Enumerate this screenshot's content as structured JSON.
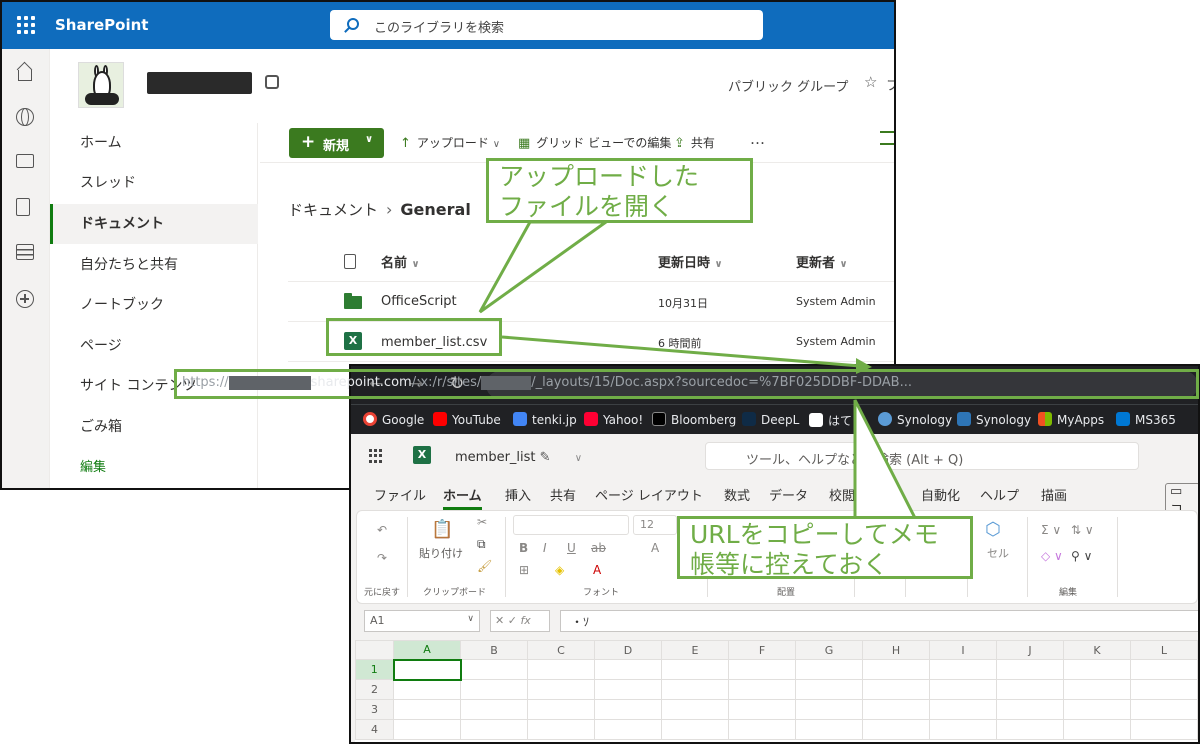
{
  "sharepoint": {
    "brand": "SharePoint",
    "search_placeholder": "このライブラリを検索",
    "group_type": "パブリック グループ",
    "group_more": "フ",
    "nav": [
      "ホーム",
      "スレッド",
      "ドキュメント",
      "自分たちと共有",
      "ノートブック",
      "ページ",
      "サイト コンテンツ",
      "ごみ箱",
      "編集"
    ],
    "active_nav": "ドキュメント",
    "commands": {
      "new": "新規",
      "upload": "アップロード",
      "grid_edit": "グリッド ビューでの編集",
      "share": "共有",
      "more": "…"
    },
    "breadcrumb": {
      "root": "ドキュメント",
      "current": "General"
    },
    "columns": {
      "name": "名前",
      "modified": "更新日時",
      "modified_by": "更新者"
    },
    "files": [
      {
        "name": "OfficeScript",
        "modified": "10月31日",
        "modified_by": "System Admin",
        "icon": "folder-icon"
      },
      {
        "name": "member_list.csv",
        "modified": "6 時間前",
        "modified_by": "System Admin",
        "icon": "excel-icon"
      }
    ]
  },
  "callouts": {
    "open_file_line1": "アップロードした",
    "open_file_line2": "ファイルを開く",
    "copy_url_line1": "URLをコピーしてメモ",
    "copy_url_line2": "帳等に控えておく"
  },
  "accent_color": "#70ad47",
  "browser": {
    "url_prefix": "https://",
    "url_host": "sharepoint.com",
    "url_path1": "/:x:/r/sites/",
    "url_path2": "/_layouts/15/Doc.aspx?sourcedoc=%7BF025DDBF-DDAB...",
    "bookmarks": [
      "Google",
      "YouTube",
      "tenki.jp",
      "Yahoo!",
      "Bloomberg",
      "DeepL",
      "はてブ",
      "Synology",
      "Synology",
      "MyApps",
      "MS365"
    ]
  },
  "excel": {
    "file_name": "member_list",
    "search_placeholder": "ツール、ヘルプなどを検索 (Alt + Q)",
    "tabs": [
      "ファイル",
      "ホーム",
      "挿入",
      "共有",
      "ページ レイアウト",
      "数式",
      "データ",
      "校閲",
      "表示",
      "自動化",
      "ヘルプ",
      "描画"
    ],
    "active_tab": "ホーム",
    "ribbon": {
      "undo_label": "元に戻す",
      "paste": "貼り付け",
      "clipboard": "クリップボード",
      "font": "フォント",
      "font_size": "12",
      "alignment": "配置",
      "cells": "セル",
      "editing": "編集"
    },
    "name_box": "A1",
    "formula_value": "・ｿ",
    "col_headers": [
      "A",
      "B",
      "C",
      "D",
      "E",
      "F",
      "G",
      "H",
      "I",
      "J",
      "K",
      "L"
    ],
    "row_headers": [
      "1",
      "2",
      "3",
      "4"
    ]
  }
}
